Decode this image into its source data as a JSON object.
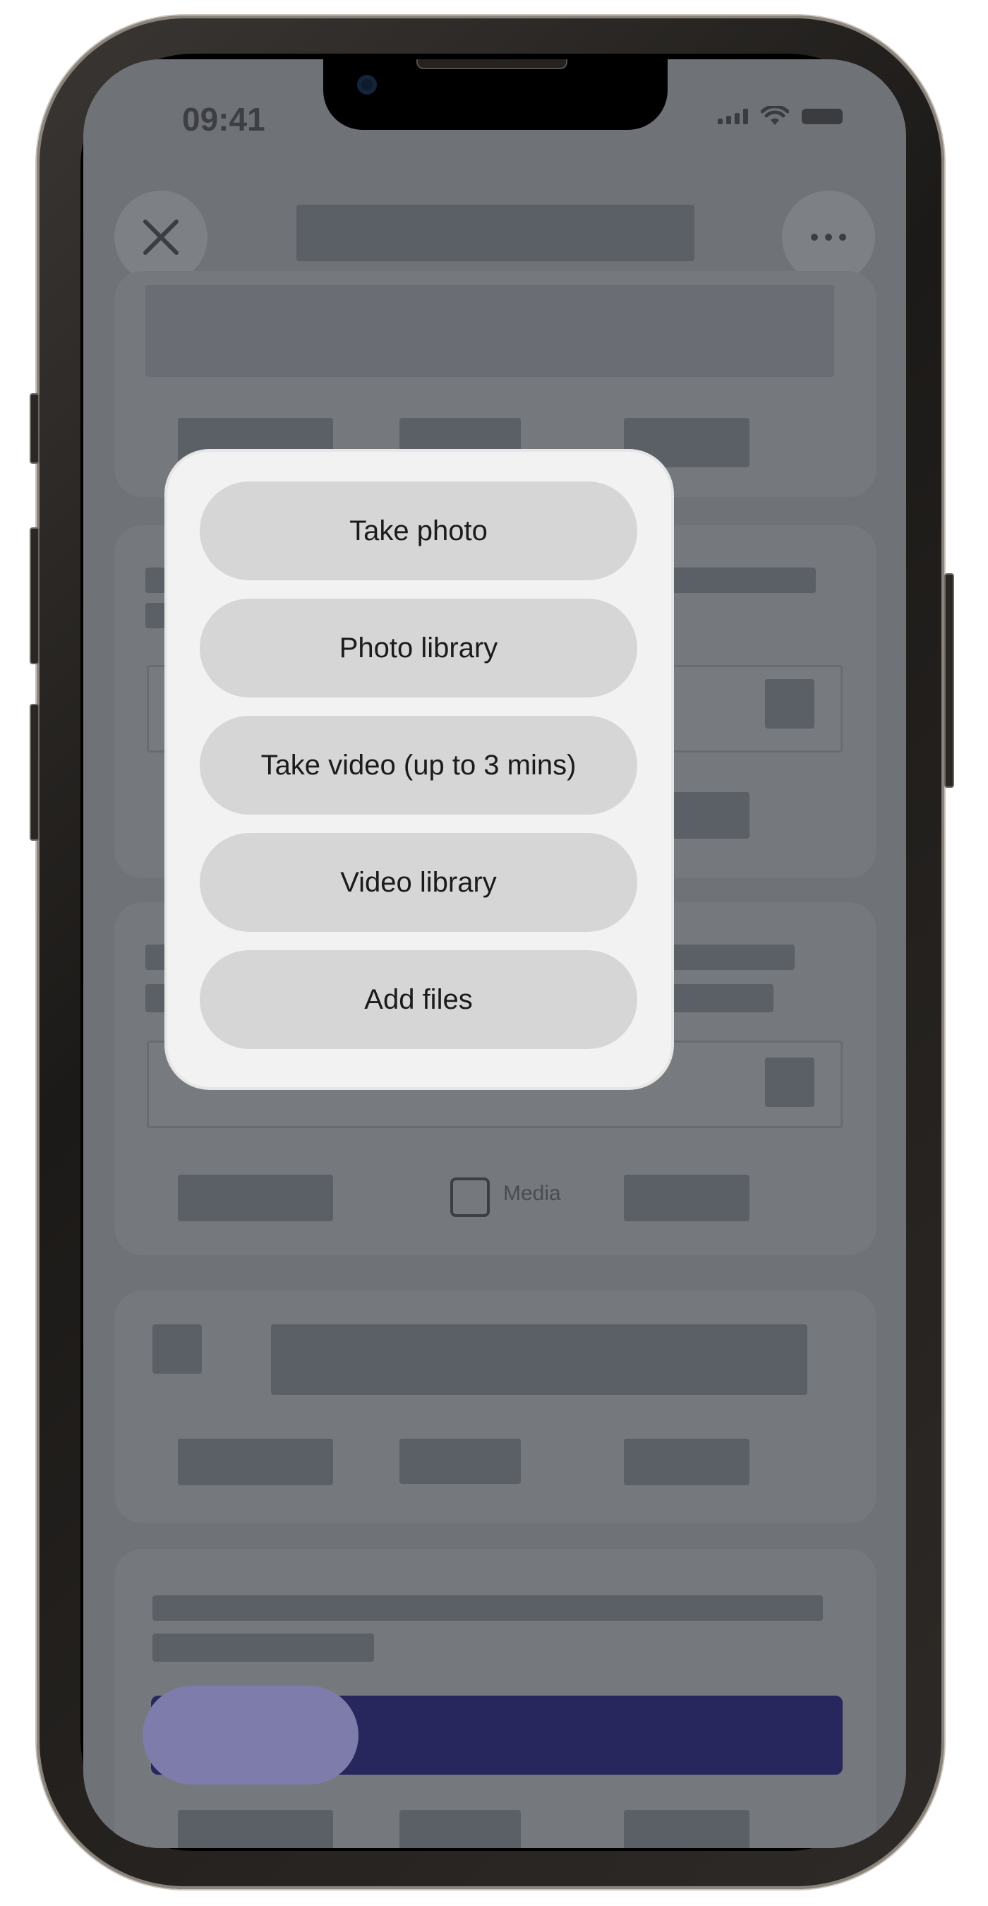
{
  "status_bar": {
    "time": "09:41"
  },
  "background": {
    "media_label": "Media"
  },
  "sheet": {
    "options": [
      {
        "label": "Take photo"
      },
      {
        "label": "Photo library"
      },
      {
        "label": "Take video (up to 3 mins)"
      },
      {
        "label": "Video library"
      },
      {
        "label": "Add files"
      }
    ]
  },
  "icons": {
    "close": "close-icon",
    "more": "more-icon",
    "signal": "signal-icon",
    "wifi": "wifi-icon",
    "battery": "battery-icon",
    "media": "image-icon"
  },
  "colors": {
    "cta": "#28275d",
    "overlay": "#6f7277",
    "sheet": "#f2f2f2",
    "option_bg": "#d6d6d6"
  }
}
